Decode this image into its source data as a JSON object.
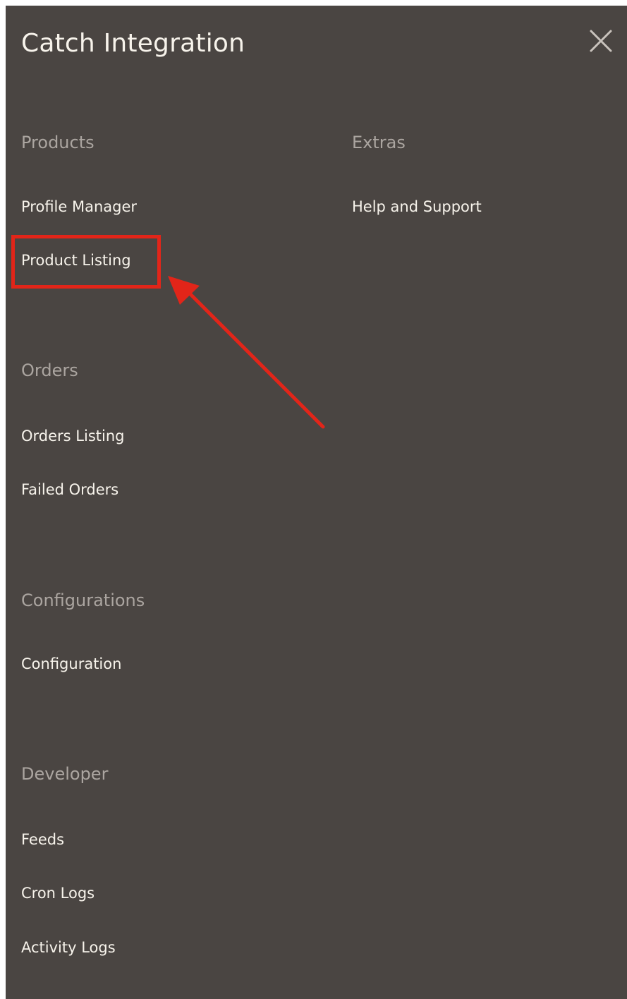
{
  "header": {
    "title": "Catch Integration",
    "close_icon": "close-icon"
  },
  "sections": {
    "products": {
      "heading": "Products",
      "items": [
        "Profile Manager",
        "Product Listing"
      ]
    },
    "extras": {
      "heading": "Extras",
      "items": [
        "Help and Support"
      ]
    },
    "orders": {
      "heading": "Orders",
      "items": [
        "Orders Listing",
        "Failed Orders"
      ]
    },
    "configurations": {
      "heading": "Configurations",
      "items": [
        "Configuration"
      ]
    },
    "developer": {
      "heading": "Developer",
      "items": [
        "Feeds",
        "Cron Logs",
        "Activity Logs"
      ]
    }
  },
  "colors": {
    "panel_background": "#4a4542",
    "heading_text": "#aba5a0",
    "link_text": "#f7f3eb",
    "annotation_red": "#e22519"
  },
  "annotation": {
    "highlighted_item": "Product Listing"
  }
}
